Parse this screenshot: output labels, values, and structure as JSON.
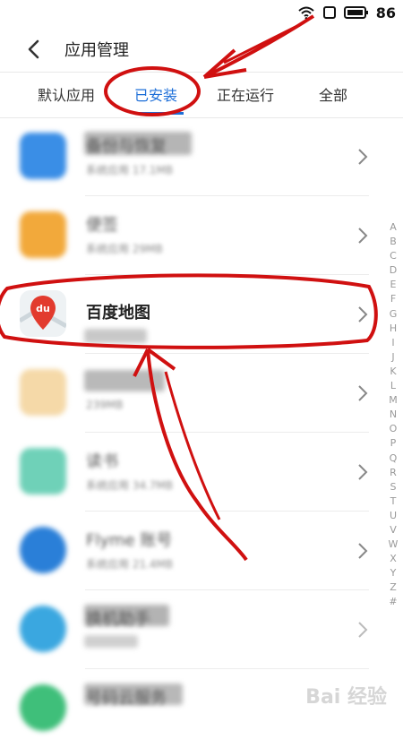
{
  "status_bar": {
    "battery": "86",
    "icons": [
      "wifi-icon",
      "sim-icon",
      "battery-icon"
    ]
  },
  "header": {
    "title": "应用管理",
    "back_icon": "chevron-left-icon"
  },
  "tabs": [
    {
      "label": "默认应用",
      "active": false
    },
    {
      "label": "已安装",
      "active": true
    },
    {
      "label": "正在运行",
      "active": false
    },
    {
      "label": "全部",
      "active": false
    }
  ],
  "apps": [
    {
      "name": "备份与恢复",
      "meta": "系统应用 17.1MB",
      "blurred": true,
      "icon_color": "#3a8ee6"
    },
    {
      "name": "便签",
      "meta": "系统应用 29MB",
      "blurred": true,
      "icon_color": "#f2a93b"
    },
    {
      "name": "百度地图",
      "meta": "",
      "blurred": false,
      "icon_color": "#e8eef2"
    },
    {
      "name": "",
      "meta": "239MB",
      "blurred": true,
      "icon_color": "#f5d9a8"
    },
    {
      "name": "读书",
      "meta": "系统应用 34.7MB",
      "blurred": true,
      "icon_color": "#6fd1b8"
    },
    {
      "name": "Flyme 账号",
      "meta": "系统应用 21.4MB",
      "blurred": true,
      "icon_color": "#2a7fd8"
    },
    {
      "name": "换机助手",
      "meta": "",
      "blurred": true,
      "icon_color": "#3aa7e0"
    },
    {
      "name": "号码云服务",
      "meta": "",
      "blurred": true,
      "icon_color": "#3fbf7a"
    }
  ],
  "alpha_index": [
    "A",
    "B",
    "C",
    "D",
    "E",
    "F",
    "G",
    "H",
    "I",
    "J",
    "K",
    "L",
    "M",
    "N",
    "O",
    "P",
    "Q",
    "R",
    "S",
    "T",
    "U",
    "V",
    "W",
    "X",
    "Y",
    "Z",
    "#"
  ],
  "colors": {
    "accent": "#1e6fd8",
    "annotation": "#d01010"
  },
  "watermark": "Bai 经验"
}
